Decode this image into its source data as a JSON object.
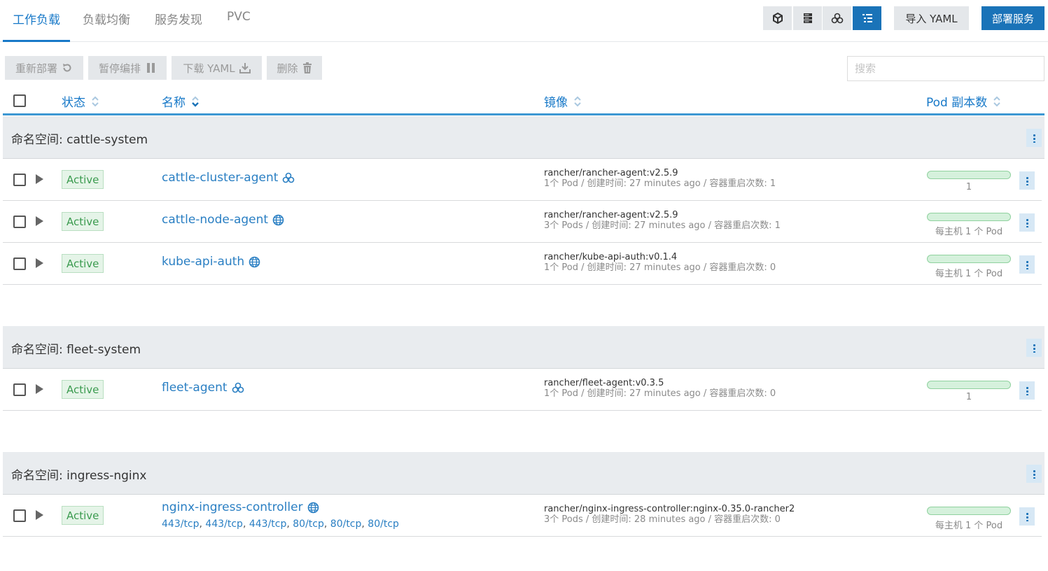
{
  "tabs": [
    {
      "label": "工作负载",
      "active": true
    },
    {
      "label": "负载均衡",
      "active": false
    },
    {
      "label": "服务发现",
      "active": false
    },
    {
      "label": "PVC",
      "active": false
    }
  ],
  "view_modes": [
    "cube-icon",
    "server-icon",
    "cluster-icon",
    "list-tree-icon"
  ],
  "actions": {
    "import_label": "导入 YAML",
    "deploy_label": "部署服务"
  },
  "bulk_actions": [
    {
      "label": "重新部署",
      "icon": "redeploy-icon"
    },
    {
      "label": "暂停编排",
      "icon": "pause-icon"
    },
    {
      "label": "下载 YAML",
      "icon": "download-icon"
    },
    {
      "label": "删除",
      "icon": "trash-icon"
    }
  ],
  "search": {
    "placeholder": "搜索",
    "value": ""
  },
  "columns": {
    "status": "状态",
    "name": "名称",
    "image": "镜像",
    "pods": "Pod 副本数"
  },
  "namespace_prefix": "命名空间:",
  "namespaces": [
    {
      "name": "cattle-system",
      "workloads": [
        {
          "status": "Active",
          "name": "cattle-cluster-agent",
          "type_icon": "deployment-icon",
          "image": "rancher/rancher-agent:v2.5.9",
          "meta": "1个 Pod  /  创建时间: 27 minutes ago  /  容器重启次数: 1",
          "pods": "1"
        },
        {
          "status": "Active",
          "name": "cattle-node-agent",
          "type_icon": "daemonset-globe-icon",
          "image": "rancher/rancher-agent:v2.5.9",
          "meta": "3个 Pods  /  创建时间: 27 minutes ago  /  容器重启次数: 1",
          "pods": "每主机 1 个 Pod"
        },
        {
          "status": "Active",
          "name": "kube-api-auth",
          "type_icon": "daemonset-globe-icon",
          "image": "rancher/kube-api-auth:v0.1.4",
          "meta": "1个 Pod  /  创建时间: 27 minutes ago  /  容器重启次数: 0",
          "pods": "每主机 1 个 Pod"
        }
      ]
    },
    {
      "name": "fleet-system",
      "workloads": [
        {
          "status": "Active",
          "name": "fleet-agent",
          "type_icon": "deployment-icon",
          "image": "rancher/fleet-agent:v0.3.5",
          "meta": "1个 Pod  /  创建时间: 27 minutes ago  /  容器重启次数: 0",
          "pods": "1"
        }
      ]
    },
    {
      "name": "ingress-nginx",
      "workloads": [
        {
          "status": "Active",
          "name": "nginx-ingress-controller",
          "type_icon": "daemonset-globe-icon",
          "image": "rancher/nginx-ingress-controller:nginx-0.35.0-rancher2",
          "meta": "3个 Pods  /  创建时间: 28 minutes ago  /  容器重启次数: 0",
          "pods": "每主机 1 个 Pod",
          "ports": [
            "443/tcp",
            "443/tcp",
            "443/tcp",
            "80/tcp",
            "80/tcp",
            "80/tcp"
          ]
        }
      ]
    }
  ],
  "colors": {
    "accent": "#1a73b8",
    "link": "#2a7fc3",
    "active_green": "#3b9b4f",
    "namespace_bg": "#e9ecef"
  }
}
